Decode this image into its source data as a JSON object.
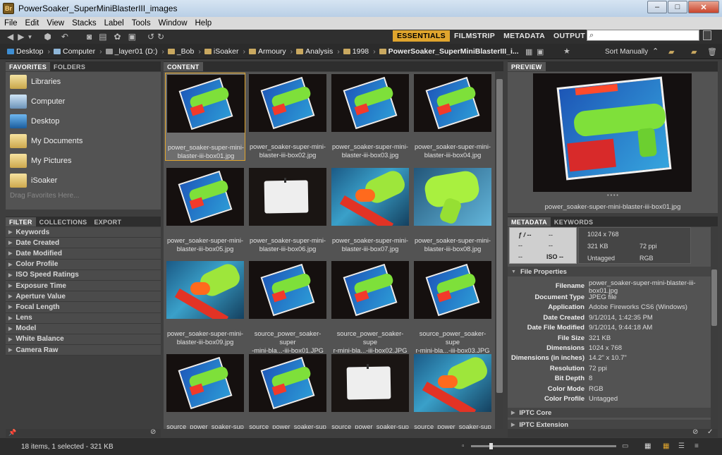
{
  "window": {
    "title": "PowerSoaker_SuperMiniBlasterIII_images",
    "app_icon": "Br",
    "minimize": "–",
    "maximize": "□",
    "close": "✕"
  },
  "menu": [
    "File",
    "Edit",
    "View",
    "Stacks",
    "Label",
    "Tools",
    "Window",
    "Help"
  ],
  "workspaces": {
    "essentials": "ESSENTIALS",
    "filmstrip": "FILMSTRIP",
    "metadata": "METADATA",
    "output": "OUTPUT"
  },
  "search": {
    "value": ""
  },
  "path": [
    "Desktop",
    "Computer",
    "_layer01 (D:)",
    "_Bob",
    "iSoaker",
    "Armoury",
    "Analysis",
    "1998",
    "PowerSoaker_SuperMiniBlasterIII_i..."
  ],
  "sort": {
    "label": "Sort Manually"
  },
  "left_tabs": {
    "favorites": "FAVORITES",
    "folders": "FOLDERS"
  },
  "favorites": [
    "Libraries",
    "Computer",
    "Desktop",
    "My Documents",
    "My Pictures",
    "iSoaker"
  ],
  "drag_favorites": "Drag Favorites Here...",
  "filter_tabs": {
    "filter": "FILTER",
    "collections": "COLLECTIONS",
    "export": "EXPORT"
  },
  "filters": [
    "Keywords",
    "Date Created",
    "Date Modified",
    "Color Profile",
    "ISO Speed Ratings",
    "Exposure Time",
    "Aperture Value",
    "Focal Length",
    "Lens",
    "Model",
    "White Balance",
    "Camera Raw"
  ],
  "content_tab": "CONTENT",
  "thumbs": [
    {
      "l1": "power_soaker-super-mini-",
      "l2": "blaster-iii-box01.jpg",
      "kind": "box",
      "sel": true
    },
    {
      "l1": "power_soaker-super-mini-",
      "l2": "blaster-iii-box02.jpg",
      "kind": "box"
    },
    {
      "l1": "power_soaker-super-mini-",
      "l2": "blaster-iii-box03.jpg",
      "kind": "box"
    },
    {
      "l1": "power_soaker-super-mini-",
      "l2": "blaster-iii-box04.jpg",
      "kind": "box"
    },
    {
      "l1": "power_soaker-super-mini-",
      "l2": "blaster-iii-box05.jpg",
      "kind": "box"
    },
    {
      "l1": "power_soaker-super-mini-",
      "l2": "blaster-iii-box06.jpg",
      "kind": "card"
    },
    {
      "l1": "power_soaker-super-mini-",
      "l2": "blaster-iii-box07.jpg",
      "kind": "close"
    },
    {
      "l1": "power_soaker-super-mini-",
      "l2": "blaster-iii-box08.jpg",
      "kind": "closegun"
    },
    {
      "l1": "power_soaker-super-mini-",
      "l2": "blaster-iii-box09.jpg",
      "kind": "close2"
    },
    {
      "l1": "source_power_soaker-super",
      "l2": "-mini-bla...-iii-box01.JPG",
      "kind": "box"
    },
    {
      "l1": "source_power_soaker-supe",
      "l2": "r-mini-bla...-iii-box02.JPG",
      "kind": "box"
    },
    {
      "l1": "source_power_soaker-supe",
      "l2": "r-mini-bla...-iii-box03.JPG",
      "kind": "box"
    },
    {
      "l1": "source_power_soaker-sup",
      "l2": "",
      "kind": "box"
    },
    {
      "l1": "source_power_soaker-sup",
      "l2": "",
      "kind": "box"
    },
    {
      "l1": "source_power_soaker-sup",
      "l2": "",
      "kind": "card"
    },
    {
      "l1": "source_power_soaker-sup",
      "l2": "",
      "kind": "close"
    }
  ],
  "preview_tab": "PREVIEW",
  "preview_caption": "power_soaker-super-mini-blaster-iii-box01.jpg",
  "preview_dots": "• • • •",
  "meta_tabs": {
    "metadata": "METADATA",
    "keywords": "KEYWORDS"
  },
  "camera": {
    "f": "ƒ / --",
    "exp": "--",
    "a": "--",
    "b": "--",
    "iso": "ISO --"
  },
  "fileinfo": {
    "dims": "1024 x 768",
    "size": "321 KB",
    "ppi": "72 ppi",
    "tag": "Untagged",
    "mode": "RGB"
  },
  "file_properties_label": "File Properties",
  "props": [
    {
      "k": "Filename",
      "v": "power_soaker-super-mini-blaster-iii-box01.jpg"
    },
    {
      "k": "Document Type",
      "v": "JPEG file"
    },
    {
      "k": "Application",
      "v": "Adobe Fireworks CS6 (Windows)"
    },
    {
      "k": "Date Created",
      "v": "9/1/2014, 1:42:35 PM"
    },
    {
      "k": "Date File Modified",
      "v": "9/1/2014, 9:44:18 AM"
    },
    {
      "k": "File Size",
      "v": "321 KB"
    },
    {
      "k": "Dimensions",
      "v": "1024 x 768"
    },
    {
      "k": "Dimensions (in inches)",
      "v": "14.2\" x 10.7\""
    },
    {
      "k": "Resolution",
      "v": "72 ppi"
    },
    {
      "k": "Bit Depth",
      "v": "8"
    },
    {
      "k": "Color Mode",
      "v": "RGB"
    },
    {
      "k": "Color Profile",
      "v": "Untagged"
    }
  ],
  "iptc_core": "IPTC Core",
  "iptc_ext": "IPTC Extension",
  "status": "18 items, 1 selected - 321 KB",
  "thumb_slider_value": 0.13,
  "colors": {
    "accent": "#e0a52d",
    "panel": "#535353"
  }
}
